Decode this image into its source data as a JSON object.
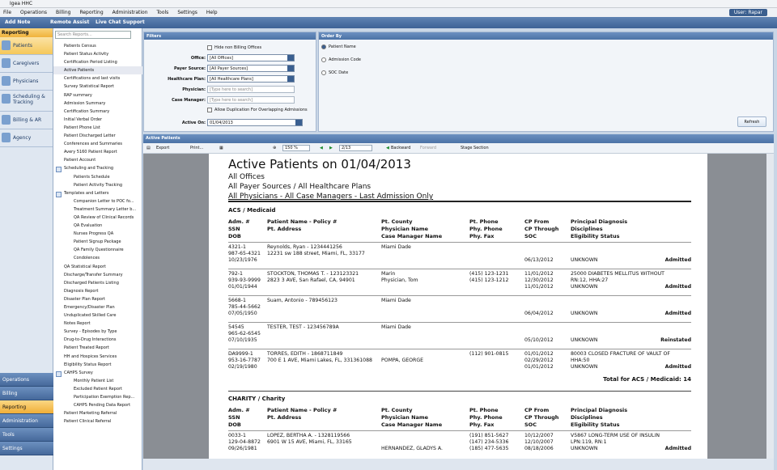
{
  "app": {
    "title": "Igea HHC",
    "user_label": "User:",
    "user_name": "Rapar"
  },
  "menu": [
    "File",
    "Operations",
    "Billing",
    "Reporting",
    "Administration",
    "Tools",
    "Settings",
    "Help"
  ],
  "toolbar": {
    "add_note": "Add Note",
    "remote_assist": "Remote Assist",
    "live_chat": "Live Chat Support"
  },
  "nav": {
    "header": "Reporting",
    "items": [
      "Patients",
      "Caregivers",
      "Physicians",
      "Scheduling & Tracking",
      "Billing & AR",
      "Agency"
    ],
    "bottom": [
      "Operations",
      "Billing",
      "Reporting",
      "Administration",
      "Tools",
      "Settings"
    ]
  },
  "reports_search_placeholder": "Search Reports...",
  "reports": [
    {
      "l": "Patients Census",
      "c": false
    },
    {
      "l": "Patient Status Activity",
      "c": false
    },
    {
      "l": "Certification Period Listing",
      "c": false
    },
    {
      "l": "Active Patients",
      "c": false,
      "s": true
    },
    {
      "l": "Certifications and last visits",
      "c": false
    },
    {
      "l": "Survey Statistical Report",
      "c": false
    },
    {
      "l": "RAP summary",
      "c": false
    },
    {
      "l": "Admission Summary",
      "c": false
    },
    {
      "l": "Certification Summary",
      "c": false
    },
    {
      "l": "Initial Verbal Order",
      "c": false
    },
    {
      "l": "Patient Phone List",
      "c": false
    },
    {
      "l": "Patient Discharged Letter",
      "c": false
    },
    {
      "l": "Conferences and Summaries",
      "c": false
    },
    {
      "l": "Avery 5160 Patient Report",
      "c": false
    },
    {
      "l": "Patient Account",
      "c": false
    },
    {
      "l": "Scheduling and Tracking",
      "c": false,
      "g": true
    },
    {
      "l": "Patients Schedule",
      "c": true
    },
    {
      "l": "Patient Activity Tracking",
      "c": true
    },
    {
      "l": "Templates and Letters",
      "c": false,
      "g": true
    },
    {
      "l": "Companion Letter to POC fo...",
      "c": true
    },
    {
      "l": "Treatment Summary Letter b...",
      "c": true
    },
    {
      "l": "QA Review of Clinical Records",
      "c": true
    },
    {
      "l": "QA Evaluation",
      "c": true
    },
    {
      "l": "Nurses Progress QA",
      "c": true
    },
    {
      "l": "Patient Signup Package",
      "c": true
    },
    {
      "l": "QA Family Questionnaire",
      "c": true
    },
    {
      "l": "Condolences",
      "c": true
    },
    {
      "l": "QA Statistical Report",
      "c": false
    },
    {
      "l": "Discharge/Transfer Summary",
      "c": false
    },
    {
      "l": "Discharged Patients Listing",
      "c": false
    },
    {
      "l": "Diagnosis Report",
      "c": false
    },
    {
      "l": "Disaster Plan Report",
      "c": false
    },
    {
      "l": "Emergency/Disaster Plan",
      "c": false
    },
    {
      "l": "Unduplicated Skilled Care",
      "c": false
    },
    {
      "l": "Notes Report",
      "c": false
    },
    {
      "l": "Survey - Episodes by Type",
      "c": false
    },
    {
      "l": "Drug-to-Drug Interactions",
      "c": false
    },
    {
      "l": "Patient Treated Report",
      "c": false
    },
    {
      "l": "HH and Hospices Services",
      "c": false
    },
    {
      "l": "Eligibility Status Report",
      "c": false
    },
    {
      "l": "CAHPS Survey",
      "c": false,
      "g": true
    },
    {
      "l": "Monthly Patient List",
      "c": true
    },
    {
      "l": "Excluded Patient Report",
      "c": true
    },
    {
      "l": "Participation Exemption Rep...",
      "c": true
    },
    {
      "l": "CAHPS Pending Data Report",
      "c": true
    },
    {
      "l": "Patient Marketing Referral",
      "c": false
    },
    {
      "l": "Patient Clinical Referral",
      "c": false
    }
  ],
  "filters": {
    "title": "Filters",
    "hide_non_billing": "Hide non Billing Offices",
    "office_label": "Office:",
    "office": "[All Offices]",
    "payer_label": "Payer Source:",
    "payer": "[All Payer Sources]",
    "plan_label": "Healthcare Plan:",
    "plan": "[All Healthcare Plans]",
    "physician_label": "Physician:",
    "physician_ph": "[Type here to search]",
    "cm_label": "Case Manager:",
    "cm_ph": "[Type here to search]",
    "dup_label": "Allow Duplication For Overlapping Admissions",
    "active_on_label": "Active On:",
    "active_on": "01/04/2013"
  },
  "order_by": {
    "title": "Order By",
    "options": [
      "Patient Name",
      "Admission Code",
      "SOC Date"
    ],
    "refresh": "Refresh"
  },
  "report_panel": {
    "title": "Active Patients",
    "export": "Export",
    "print": "Print...",
    "zoom": "150 %",
    "page": "2/13",
    "backward": "Backward",
    "forward": "Forward",
    "stage": "Stage Section"
  },
  "report": {
    "title": "Active Patients on 01/04/2013",
    "sub1": "All Offices",
    "sub2": "All Payer Sources / All Healthcare Plans",
    "sub3": "All Physicians - All Case Managers - Last Admission Only",
    "sections": [
      {
        "name": "ACS / Medicaid",
        "total": "Total for ACS / Medicaid: 14",
        "rows": [
          {
            "adm": "4321-1",
            "ssn": "987-65-4321",
            "dob": "10/23/1976",
            "name": "Reynolds, Ryan - 1234441256",
            "addr": "12231 sw 188 street, Miami, FL, 33177",
            "county": "Miami Dade",
            "phys": "",
            "cm": "",
            "ph": "",
            "phyph": "",
            "fax": "",
            "from": "",
            "thru": "",
            "soc": "06/13/2012",
            "dx": "",
            "disc": "",
            "elig": "UNKNOWN",
            "status": "Admitted"
          },
          {
            "adm": "792-1",
            "ssn": "939-93-9999",
            "dob": "01/01/1944",
            "name": "STOCKTON, THOMAS T. - 123123321",
            "addr": "2823 3 AVE, San Rafael, CA, 94901",
            "county": "Marin",
            "phys": "Physician, Tom",
            "cm": "",
            "ph": "(415) 123-1231",
            "phyph": "(415) 123-1212",
            "fax": "",
            "from": "11/01/2012",
            "thru": "12/30/2012",
            "soc": "11/01/2012",
            "dx": "25000 DIABETES MELLITUS WITHOUT",
            "disc": "RN:12, HHA:27",
            "elig": "UNKNOWN",
            "status": "Admitted"
          },
          {
            "adm": "5668-1",
            "ssn": "785-44-5662",
            "dob": "07/05/1950",
            "name": "Suam, Antonio - 789456123",
            "addr": "",
            "county": "Miami Dade",
            "phys": "",
            "cm": "",
            "ph": "",
            "phyph": "",
            "fax": "",
            "from": "",
            "thru": "",
            "soc": "06/04/2012",
            "dx": "",
            "disc": "",
            "elig": "UNKNOWN",
            "status": "Admitted"
          },
          {
            "adm": "54545",
            "ssn": "965-62-6545",
            "dob": "07/10/1935",
            "name": "TESTER, TEST - 123456789A",
            "addr": "",
            "county": "Miami Dade",
            "phys": "",
            "cm": "",
            "ph": "",
            "phyph": "",
            "fax": "",
            "from": "",
            "thru": "",
            "soc": "05/10/2012",
            "dx": "",
            "disc": "",
            "elig": "UNKNOWN",
            "status": "Reinstated"
          },
          {
            "adm": "DA9999-1",
            "ssn": "953-16-7787",
            "dob": "02/19/1980",
            "name": "TORRES, EDITH - 1868711849",
            "addr": "700 E 1 AVE, Miami Lakes, FL, 331361088",
            "county": "",
            "phys": "POMPA, GEORGE",
            "cm": "",
            "ph": "(112) 901-0815",
            "phyph": "",
            "fax": "",
            "from": "01/01/2012",
            "thru": "02/29/2012",
            "soc": "01/01/2012",
            "dx": "80003 CLOSED FRACTURE OF VAULT OF",
            "disc": "HHA:50",
            "elig": "UNKNOWN",
            "status": "Admitted"
          }
        ]
      },
      {
        "name": "CHARITY / Charity",
        "total": "",
        "rows": [
          {
            "adm": "0033-1",
            "ssn": "129-04-8872",
            "dob": "09/26/1981",
            "name": "LOPEZ, BERTHA A. - 1328119566",
            "addr": "6901 W 15 AVE, Miami, FL, 33165",
            "county": "",
            "phys": "",
            "cm": "HERNANDEZ, GLADYS A.",
            "ph": "(191) 851-5627",
            "phyph": "(147) 234-5336",
            "fax": "(185) 477-5635",
            "from": "10/12/2007",
            "thru": "12/10/2007",
            "soc": "08/18/2006",
            "dx": "V5867 LONG-TERM USE OF INSULIN",
            "disc": "LPN:119, RN:1",
            "elig": "UNKNOWN",
            "status": "Admitted"
          }
        ]
      }
    ],
    "col_headers": {
      "c1": [
        "Adm. #",
        "SSN",
        "DOB"
      ],
      "c2": [
        "Patient Name - Policy #",
        "Pt. Address"
      ],
      "c3": [
        "Pt. County",
        "Physician Name",
        "Case Manager Name"
      ],
      "c4": [
        "Pt. Phone",
        "Phy. Phone",
        "Phy. Fax"
      ],
      "c5": [
        "CP From",
        "CP Through",
        "SOC"
      ],
      "c6": [
        "Principal Diagnosis",
        "Disciplines",
        "Eligibility Status"
      ]
    }
  },
  "colors": {
    "accent": "#4b72a6",
    "nav_active": "#f5c75a"
  }
}
